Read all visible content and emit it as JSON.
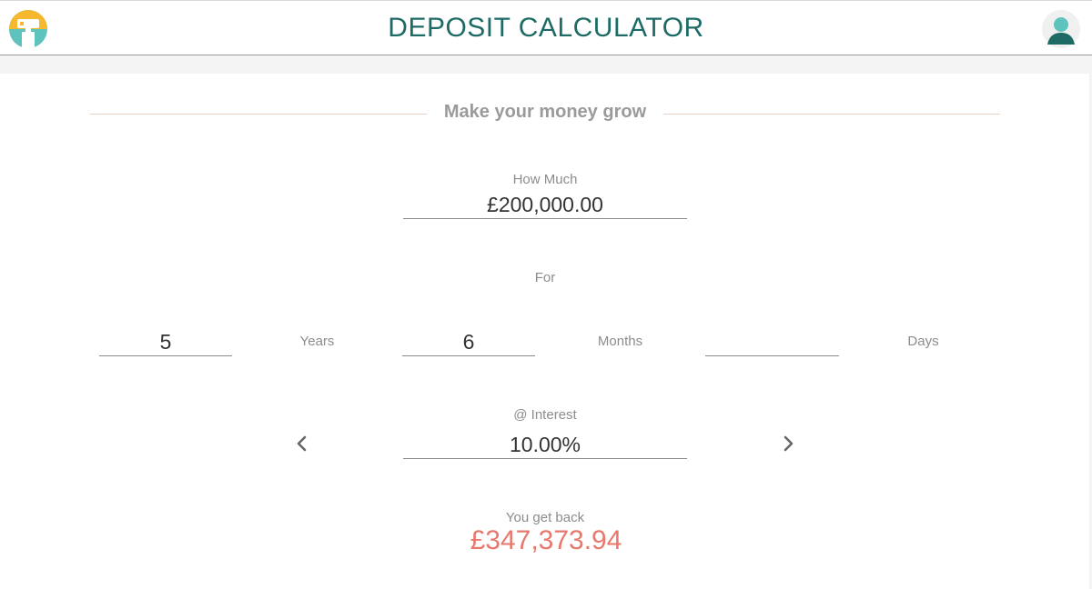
{
  "header": {
    "title": "DEPOSIT CALCULATOR",
    "logo_icon": "paint-roller-logo-icon",
    "avatar_icon": "user-avatar-icon"
  },
  "section": {
    "title": "Make your money grow"
  },
  "amount": {
    "label": "How Much",
    "value": "£200,000.00"
  },
  "duration": {
    "label": "For",
    "years_value": "5",
    "years_unit": "Years",
    "months_value": "6",
    "months_unit": "Months",
    "days_value": "",
    "days_unit": "Days"
  },
  "interest": {
    "label": "@ Interest",
    "value": "10.00%",
    "decrease_icon": "chevron-left-icon",
    "increase_icon": "chevron-right-icon"
  },
  "result": {
    "label": "You get back",
    "value": "£347,373.94"
  },
  "colors": {
    "title": "#1e6b66",
    "result": "#e8776c",
    "teal": "#5fc3bd",
    "logo_yellow": "#f5b82e",
    "divider": "#e6cfc3"
  }
}
